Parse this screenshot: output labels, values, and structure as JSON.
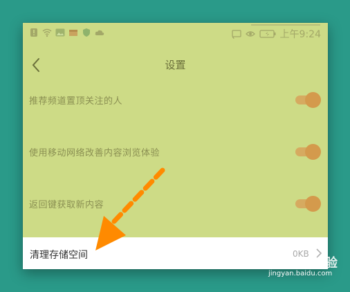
{
  "status_bar": {
    "time": "上午9:24",
    "icons_left": [
      "alert-icon",
      "wifi-icon",
      "image-icon",
      "package-icon",
      "shield-icon",
      "cloud-icon"
    ],
    "icons_right": [
      "cast-icon",
      "eye-icon",
      "battery-icon"
    ]
  },
  "header": {
    "title": "设置"
  },
  "settings": [
    {
      "label": "推荐频道置顶关注的人",
      "enabled": true
    },
    {
      "label": "使用移动网络改善内容浏览体验",
      "enabled": true
    },
    {
      "label": "返回键获取新内容",
      "enabled": true
    }
  ],
  "storage": {
    "label": "清理存储空间",
    "value": "0KB"
  },
  "watermark": {
    "brand": "Baidu 经验",
    "url": "jingyan.baidu.com"
  },
  "colors": {
    "overlay": "#cddb86",
    "accent_arrow": "#ff8a00",
    "toggle_on": "#d49a4c",
    "frame_bg": "#2a9a89"
  }
}
